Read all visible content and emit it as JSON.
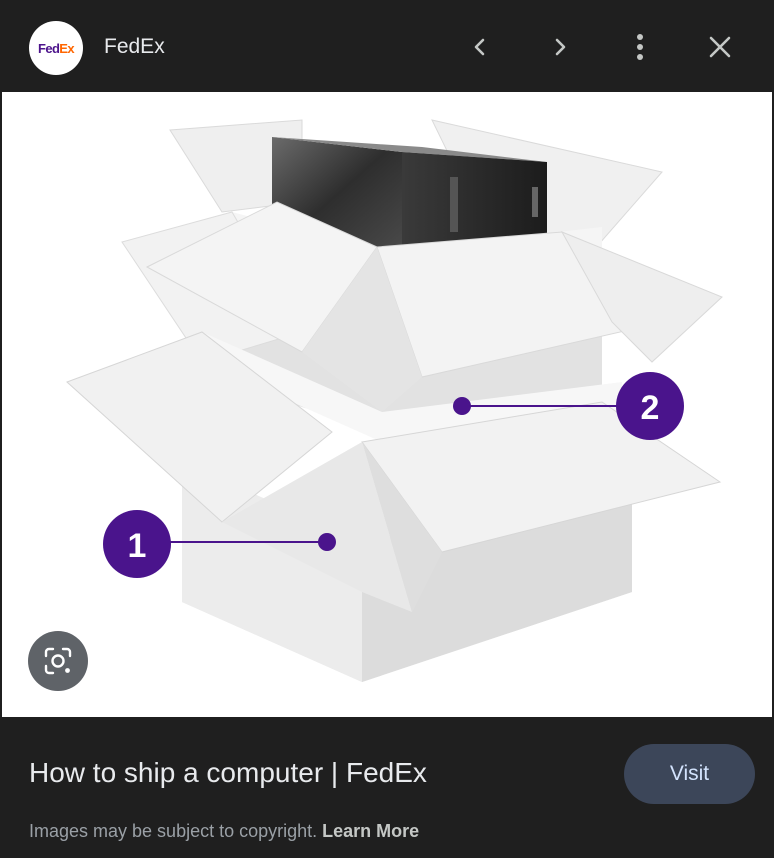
{
  "header": {
    "logo": {
      "fed": "Fed",
      "ex": "Ex"
    },
    "source_name": "FedEx",
    "icons": [
      "chevron-left-icon",
      "chevron-right-icon",
      "more-vert-icon",
      "close-icon"
    ]
  },
  "image": {
    "callouts": [
      "1",
      "2"
    ],
    "callout_color": "#4a148c",
    "lens_icon": "google-lens-icon"
  },
  "footer": {
    "title": "How to ship a computer | FedEx",
    "copyright_text": "Images may be subject to copyright.",
    "learn_more": "Learn More",
    "visit_label": "Visit"
  },
  "colors": {
    "background": "#1f1f1f",
    "visit_button": "#3c4659",
    "fedex_purple": "#4d148c",
    "fedex_orange": "#ff6600"
  }
}
